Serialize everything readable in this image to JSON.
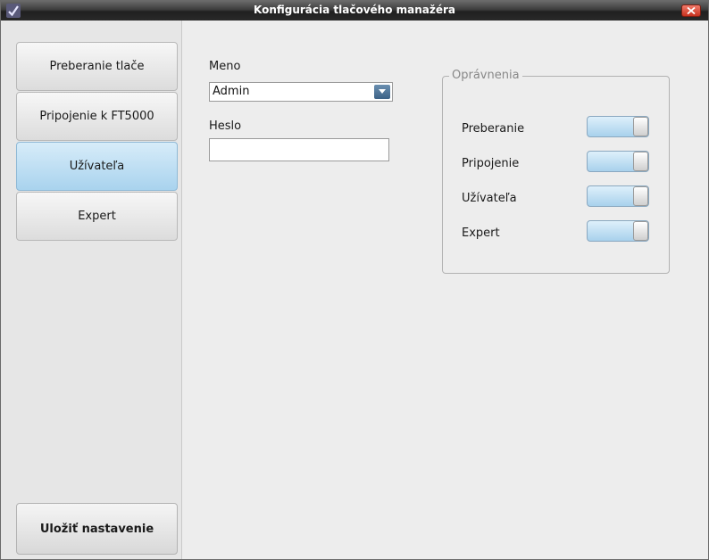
{
  "window": {
    "title": "Konfigurácia tlačového manažéra"
  },
  "sidebar": {
    "items": [
      {
        "label": "Preberanie tlače",
        "active": false
      },
      {
        "label": "Pripojenie k FT5000",
        "active": false
      },
      {
        "label": "Užívateľa",
        "active": true
      },
      {
        "label": "Expert",
        "active": false
      }
    ],
    "save_label": "Uložiť nastavenie"
  },
  "form": {
    "name_label": "Meno",
    "name_value": "Admin",
    "password_label": "Heslo",
    "password_value": ""
  },
  "permissions": {
    "title": "Oprávnenia",
    "items": [
      {
        "label": "Preberanie",
        "enabled": true
      },
      {
        "label": "Pripojenie",
        "enabled": true
      },
      {
        "label": "Užívateľa",
        "enabled": true
      },
      {
        "label": "Expert",
        "enabled": true
      }
    ]
  },
  "colors": {
    "active_tab": "#a9d3ee",
    "toggle_on": "#a8d1ec",
    "close_button": "#c8321f"
  },
  "icons": {
    "app": "checkmark-icon",
    "close": "close-icon",
    "dropdown": "chevron-down-icon"
  }
}
